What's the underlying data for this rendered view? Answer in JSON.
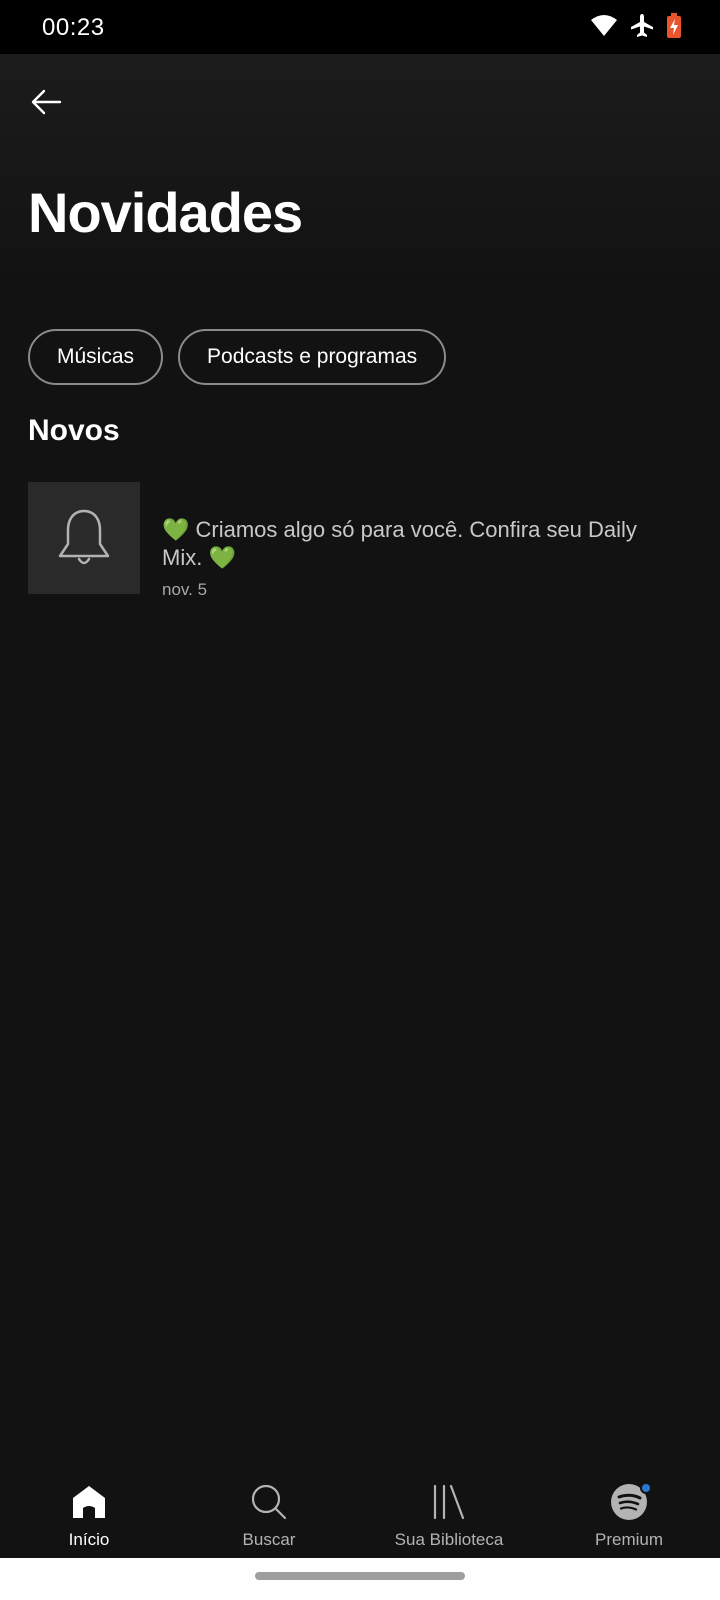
{
  "status_bar": {
    "time": "00:23",
    "icons": [
      "wifi-icon",
      "airplane-mode-icon",
      "battery-charging-icon"
    ],
    "battery_color": "#e8542c"
  },
  "header": {
    "back_icon": "arrow-left-icon",
    "title": "Novidades"
  },
  "filters": {
    "chips": [
      {
        "label": "Músicas"
      },
      {
        "label": "Podcasts e programas"
      }
    ]
  },
  "section": {
    "title": "Novos"
  },
  "notifications": [
    {
      "icon": "bell-icon",
      "message": "💚 Criamos algo só para você. Confira seu Daily Mix. 💚",
      "date": "nov. 5"
    }
  ],
  "bottom_nav": {
    "items": [
      {
        "label": "Início",
        "icon": "home-icon",
        "active": true
      },
      {
        "label": "Buscar",
        "icon": "search-icon",
        "active": false
      },
      {
        "label": "Sua Biblioteca",
        "icon": "library-icon",
        "active": false
      },
      {
        "label": "Premium",
        "icon": "spotify-logo-icon",
        "active": false
      }
    ],
    "badge_color": "#2e77d0"
  },
  "colors": {
    "background": "#121212",
    "text_primary": "#ffffff",
    "text_secondary": "#a7a7a7"
  }
}
